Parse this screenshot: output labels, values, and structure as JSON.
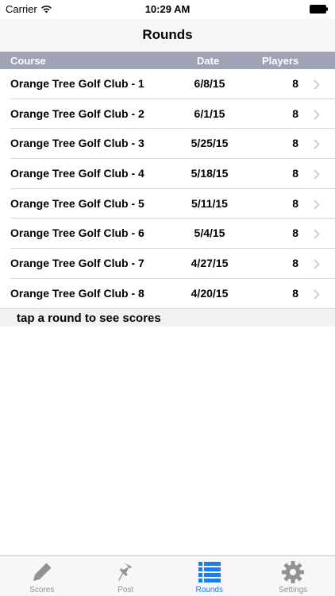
{
  "status_bar": {
    "carrier": "Carrier",
    "time": "10:29 AM",
    "icons": [
      "wifi-icon",
      "battery-icon"
    ]
  },
  "nav": {
    "title": "Rounds"
  },
  "columns": {
    "course": "Course",
    "date": "Date",
    "players": "Players"
  },
  "rounds": [
    {
      "course": "Orange Tree Golf Club - 1",
      "date": "6/8/15",
      "players": "8"
    },
    {
      "course": "Orange Tree Golf Club - 2",
      "date": "6/1/15",
      "players": "8"
    },
    {
      "course": "Orange Tree Golf Club - 3",
      "date": "5/25/15",
      "players": "8"
    },
    {
      "course": "Orange Tree Golf Club - 4",
      "date": "5/18/15",
      "players": "8"
    },
    {
      "course": "Orange Tree Golf Club - 5",
      "date": "5/11/15",
      "players": "8"
    },
    {
      "course": "Orange Tree Golf Club - 6",
      "date": "5/4/15",
      "players": "8"
    },
    {
      "course": "Orange Tree Golf Club - 7",
      "date": "4/27/15",
      "players": "8"
    },
    {
      "course": "Orange Tree Golf Club - 8",
      "date": "4/20/15",
      "players": "8"
    }
  ],
  "hint": "tap a round to see scores",
  "tabs": [
    {
      "label": "Scores",
      "icon": "pencil-icon",
      "active": false
    },
    {
      "label": "Post",
      "icon": "pin-icon",
      "active": false
    },
    {
      "label": "Rounds",
      "icon": "list-icon",
      "active": true
    },
    {
      "label": "Settings",
      "icon": "gear-icon",
      "active": false
    }
  ],
  "colors": {
    "header_bg": "#a0a3b5",
    "active_tab": "#1a7cf0",
    "inactive_tab": "#929292",
    "hint_bg": "#f2f2f2"
  }
}
